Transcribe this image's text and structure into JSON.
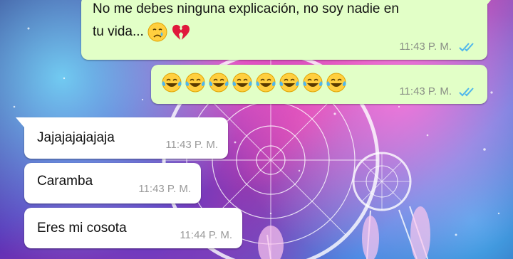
{
  "colors": {
    "outgoing_bubble": "#e2ffc7",
    "incoming_bubble": "#ffffff",
    "read_ticks": "#4fb6ec",
    "timestamp": "#8a8f86"
  },
  "messages": [
    {
      "direction": "outgoing",
      "text_line1": "No me debes ninguna explicación, no soy nadie en",
      "text_line2": "tu vida...",
      "emojis": [
        "crying-face",
        "broken-heart"
      ],
      "time": "11:43 P. M.",
      "status": "read-double-tick"
    },
    {
      "direction": "outgoing",
      "text": "",
      "emojis": [
        "tears-of-joy",
        "tears-of-joy",
        "tears-of-joy",
        "tears-of-joy",
        "tears-of-joy",
        "tears-of-joy",
        "tears-of-joy",
        "tears-of-joy"
      ],
      "time": "11:43 P. M.",
      "status": "read-double-tick"
    },
    {
      "direction": "incoming",
      "text": "Jajajajajajaja",
      "time": "11:43 P. M."
    },
    {
      "direction": "incoming",
      "text": "Caramba",
      "time": "11:43 P. M."
    },
    {
      "direction": "incoming",
      "text": "Eres mi cosota",
      "time": "11:44 P. M."
    }
  ]
}
